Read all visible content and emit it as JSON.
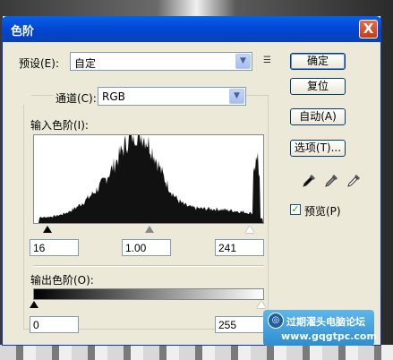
{
  "window": {
    "title": "色阶",
    "close_label": "X"
  },
  "preset": {
    "label": "预设(E):",
    "value": "自定"
  },
  "channel": {
    "label": "通道(C):",
    "value": "RGB"
  },
  "input_levels": {
    "label": "输入色阶(I):",
    "black": "16",
    "gamma": "1.00",
    "white": "241"
  },
  "output_levels": {
    "label": "输出色阶(O):",
    "black": "0",
    "white": "255"
  },
  "buttons": {
    "ok": "确定",
    "reset": "复位",
    "auto": "自动(A)",
    "options": "选项(T)..."
  },
  "preview": {
    "label": "预览(P)",
    "checked": true
  },
  "watermark": {
    "title": "过期濯头电脑论坛",
    "url": "www.gqgtpc.com"
  },
  "icons": {
    "preset_menu": "preset-options-icon",
    "black_eyedropper": "black-eyedropper-icon",
    "gray_eyedropper": "gray-eyedropper-icon",
    "white_eyedropper": "white-eyedropper-icon"
  }
}
